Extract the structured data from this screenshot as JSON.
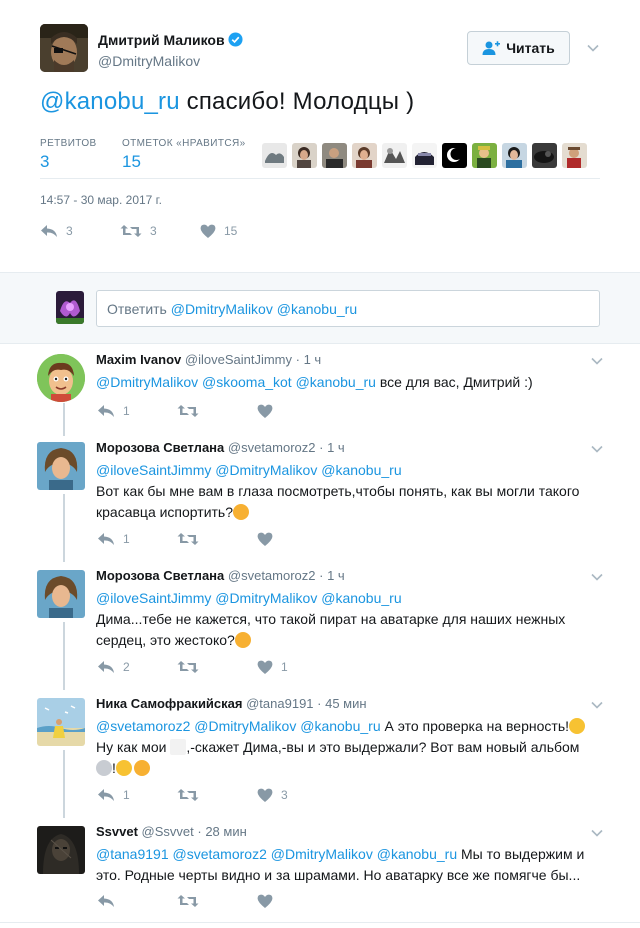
{
  "main_tweet": {
    "author_name": "Дмитрий Маликов",
    "author_handle": "@DmitryMalikov",
    "follow_label": "Читать",
    "text_mention": "@kanobu_ru",
    "text_rest": " спасибо! Молодцы )",
    "retweets_label": "РЕТВИТОВ",
    "retweets_count": "3",
    "likes_label": "ОТМЕТОК «НРАВИТСЯ»",
    "likes_count": "15",
    "timestamp": "14:57 - 30 мар. 2017 г.",
    "actions": {
      "reply": "3",
      "retweet": "3",
      "like": "15"
    }
  },
  "reply_box": {
    "prefix": "Ответить ",
    "mentions": "@DmitryMalikov @kanobu_ru"
  },
  "replies": [
    {
      "name": "Maxim Ivanov",
      "handle": "@iloveSaintJimmy",
      "time": "1 ч",
      "mentions": "@DmitryMalikov @skooma_kot @kanobu_ru",
      "text": " все для вас, Дмитрий :)",
      "reply_count": "1",
      "retweet_count": "",
      "like_count": ""
    },
    {
      "name": "Морозова Светлана",
      "handle": "@svetamoroz2",
      "time": "1 ч",
      "mentions": "@iloveSaintJimmy @DmitryMalikov @kanobu_ru",
      "line2": "Вот как бы мне вам в глаза посмотреть,чтобы понять, как вы могли  такого",
      "line3": "красавца испортить?",
      "reply_count": "1",
      "retweet_count": "",
      "like_count": ""
    },
    {
      "name": "Морозова Светлана",
      "handle": "@svetamoroz2",
      "time": "1 ч",
      "mentions": "@iloveSaintJimmy @DmitryMalikov @kanobu_ru",
      "line2": "Дима...тебе не кажется, что такой пират на аватарке для наших нежных",
      "line3": "сердец, это жестоко?",
      "reply_count": "2",
      "retweet_count": "",
      "like_count": "1"
    },
    {
      "name": "Ника Самофракийская",
      "handle": "@tana9191",
      "time": "45 мин",
      "mentions": "@svetamoroz2 @DmitryMalikov @kanobu_ru",
      "text": " А это проверка на верность!",
      "line2a": "Ну как мои ",
      "line2b": ",-скажет Дима,-вы и это выдержали? Вот вам новый альбом",
      "line3": "!",
      "reply_count": "1",
      "retweet_count": "",
      "like_count": "3"
    },
    {
      "name": "Ssvvet",
      "handle": "@Ssvvet",
      "time": "28 мин",
      "mentions": "@tana9191 @svetamoroz2 @DmitryMalikov @kanobu_ru",
      "text": " Мы то выдержим и",
      "line2": "это. Родные черты видно и за шрамами. Но аватарку все же помягче бы...",
      "reply_count": "",
      "retweet_count": "",
      "like_count": ""
    }
  ],
  "separator": " · ",
  "colors": {
    "link": "#1b95e0",
    "muted": "#657786",
    "icon": "#8899a6",
    "divider": "#e6ecf0"
  }
}
